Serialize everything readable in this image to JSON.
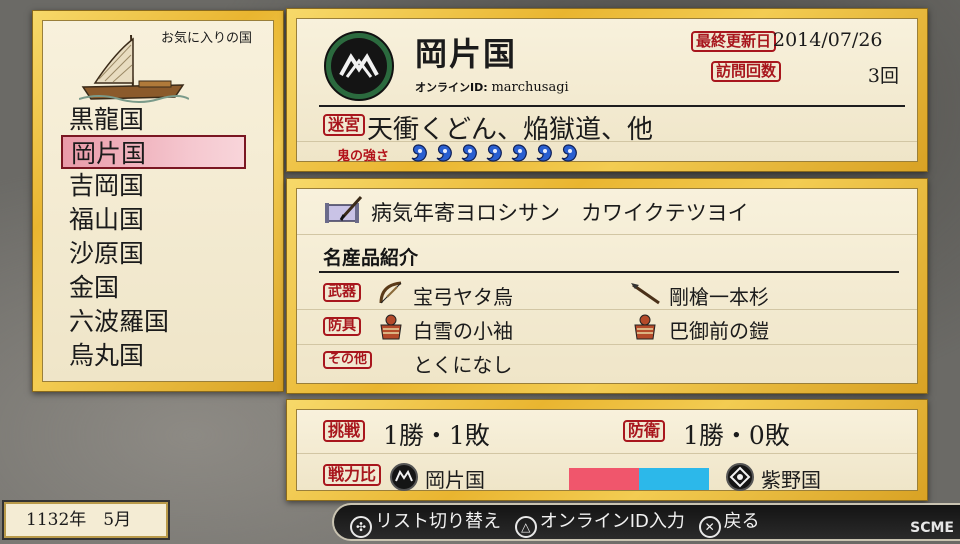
{
  "favorites": {
    "title": "お気に入りの国",
    "items": [
      "黒龍国",
      "岡片国",
      "吉岡国",
      "福山国",
      "沙原国",
      "金国",
      "六波羅国",
      "烏丸国"
    ],
    "selected_index": 1
  },
  "date": {
    "text": "1132年　5月"
  },
  "profile": {
    "country_name": "岡片国",
    "online_id_label": "オンラインID:",
    "online_id": "marchusagi",
    "last_update_label": "最終更新日",
    "last_update": "2014/07/26",
    "visits_label": "訪問回数",
    "visits": "3回",
    "labyrinth_label": "迷宮",
    "labyrinths": "天衝くどん、焔獄道、他",
    "oni_strength_label": "鬼の強さ",
    "oni_strength": 7,
    "oni_strength_max": 7
  },
  "detail": {
    "message": "病気年寄ヨロシサン　カワイクテツヨイ",
    "section_title": "名産品紹介",
    "weapon_label": "武器",
    "weapons": [
      "宝弓ヤタ烏",
      "剛槍一本杉"
    ],
    "armor_label": "防具",
    "armors": [
      "白雪の小袖",
      "巴御前の鎧"
    ],
    "other_label": "その他",
    "other": "とくになし"
  },
  "battle": {
    "challenge_label": "挑戦",
    "challenge_record": "1勝・1敗",
    "defense_label": "防衛",
    "defense_record": "1勝・0敗",
    "power_label": "戦力比",
    "own_country": "岡片国",
    "rival_country": "紫野国",
    "own_power_ratio": 0.5,
    "colors": {
      "own": "#f0566c",
      "rival": "#2cb8ea"
    }
  },
  "buttons": {
    "switch_list": "リスト切り替え",
    "enter_id": "オンラインID入力",
    "back": "戻る"
  },
  "watermark": "SCME"
}
